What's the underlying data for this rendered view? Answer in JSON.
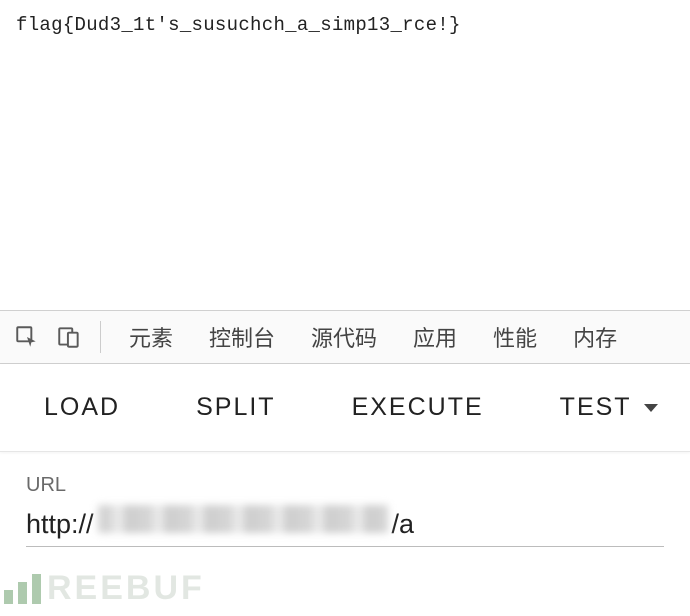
{
  "content": {
    "flag": "flag{Dud3_1t's_susuchch_a_simp13_rce!}"
  },
  "devtools": {
    "tabs": [
      "元素",
      "控制台",
      "源代码",
      "应用",
      "性能",
      "内存"
    ]
  },
  "actions": {
    "load": "LOAD",
    "split": "SPLIT",
    "execute": "EXECUTE",
    "test": "TEST"
  },
  "url_panel": {
    "label": "URL",
    "prefix": "http://",
    "suffix": "/a"
  },
  "watermark": "REEBUF"
}
